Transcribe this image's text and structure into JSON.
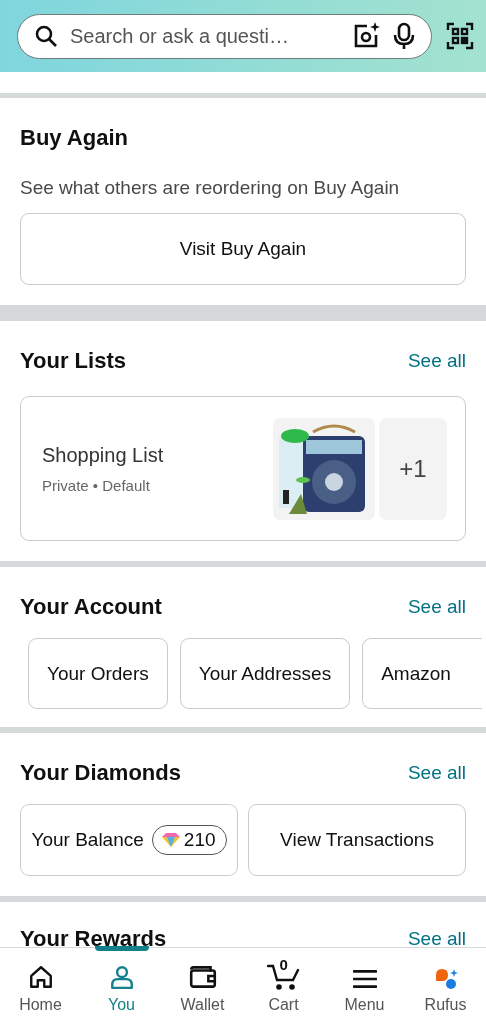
{
  "search": {
    "placeholder": "Search or ask a questi…"
  },
  "buy_again": {
    "title": "Buy Again",
    "subtitle": "See what others are reordering on Buy Again",
    "button": "Visit Buy Again"
  },
  "lists": {
    "title": "Your Lists",
    "see_all": "See all",
    "items": [
      {
        "name": "Shopping List",
        "meta": "Private • Default",
        "more_count": "+1"
      }
    ]
  },
  "account": {
    "title": "Your Account",
    "see_all": "See all",
    "buttons": [
      "Your Orders",
      "Your Addresses",
      "Amazon"
    ]
  },
  "diamonds": {
    "title": "Your Diamonds",
    "see_all": "See all",
    "balance_label": "Your Balance",
    "balance": "210",
    "button": "View Transactions"
  },
  "rewards": {
    "title": "Your Rewards",
    "see_all": "See all"
  },
  "nav": [
    {
      "kind": "home",
      "label": "Home",
      "selected": false
    },
    {
      "kind": "you",
      "label": "You",
      "selected": true
    },
    {
      "kind": "wallet",
      "label": "Wallet",
      "selected": false
    },
    {
      "kind": "cart",
      "label": "Cart",
      "selected": false,
      "badge": "0"
    },
    {
      "kind": "menu",
      "label": "Menu",
      "selected": false
    },
    {
      "kind": "rufus",
      "label": "Rufus",
      "selected": false
    }
  ]
}
